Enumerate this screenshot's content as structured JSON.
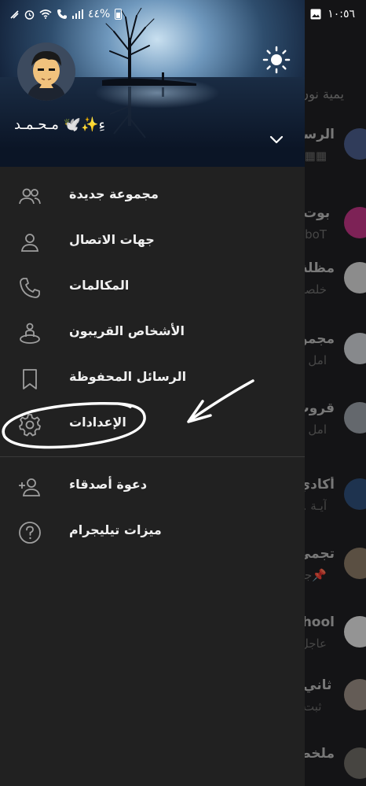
{
  "status_bar": {
    "time": "١٠:٥٦",
    "battery": "%٤٤"
  },
  "drawer": {
    "user_name": "ءِ✨🕊️ مـحـمـد",
    "menu_primary": [
      {
        "label": "مجموعة جديدة",
        "icon": "new-group-icon"
      },
      {
        "label": "جهات الاتصال",
        "icon": "contacts-icon"
      },
      {
        "label": "المكالمات",
        "icon": "calls-icon"
      },
      {
        "label": "الأشخاص القريبون",
        "icon": "people-nearby-icon"
      },
      {
        "label": "الرسائل المحفوظة",
        "icon": "bookmark-icon"
      },
      {
        "label": "الإعدادات",
        "icon": "settings-icon"
      }
    ],
    "menu_secondary": [
      {
        "label": "دعوة أصدقاء",
        "icon": "invite-friends-icon"
      },
      {
        "label": "ميزات تيليجرام",
        "icon": "help-icon"
      }
    ]
  },
  "background_chats": {
    "header_text": "يمية نون",
    "chats": [
      {
        "title": "الرسا",
        "subtitle": "▦▦▦",
        "avatar_color": "#4a5d8a"
      },
      {
        "title": "بوت",
        "subtitle": "boT.",
        "avatar_color": "#c13584"
      },
      {
        "title": "مظلة",
        "subtitle": "خلصد",
        "avatar_color": "#d8d8d8"
      },
      {
        "title": "مجمو",
        "subtitle": "امل ا",
        "avatar_color": "#cfd3d8"
      },
      {
        "title": "قروب",
        "subtitle": "امل ا",
        "avatar_color": "#9aa0a8"
      },
      {
        "title": "أكادي",
        "subtitle": "آيـة .",
        "avatar_color": "#2f4f7a"
      },
      {
        "title": "تجمي",
        "subtitle": "📌جا",
        "avatar_color": "#8a7a66"
      },
      {
        "title": "hool",
        "subtitle": "عاجل",
        "avatar_color": "#e4e4e4"
      },
      {
        "title": "ثاني",
        "subtitle": "ثبت",
        "avatar_color": "#9a8e84"
      },
      {
        "title": "ملخص",
        "subtitle": "",
        "avatar_color": "#6e6a64"
      }
    ]
  },
  "colors": {
    "drawer_bg": "#212121",
    "annotation": "#ffffff"
  }
}
